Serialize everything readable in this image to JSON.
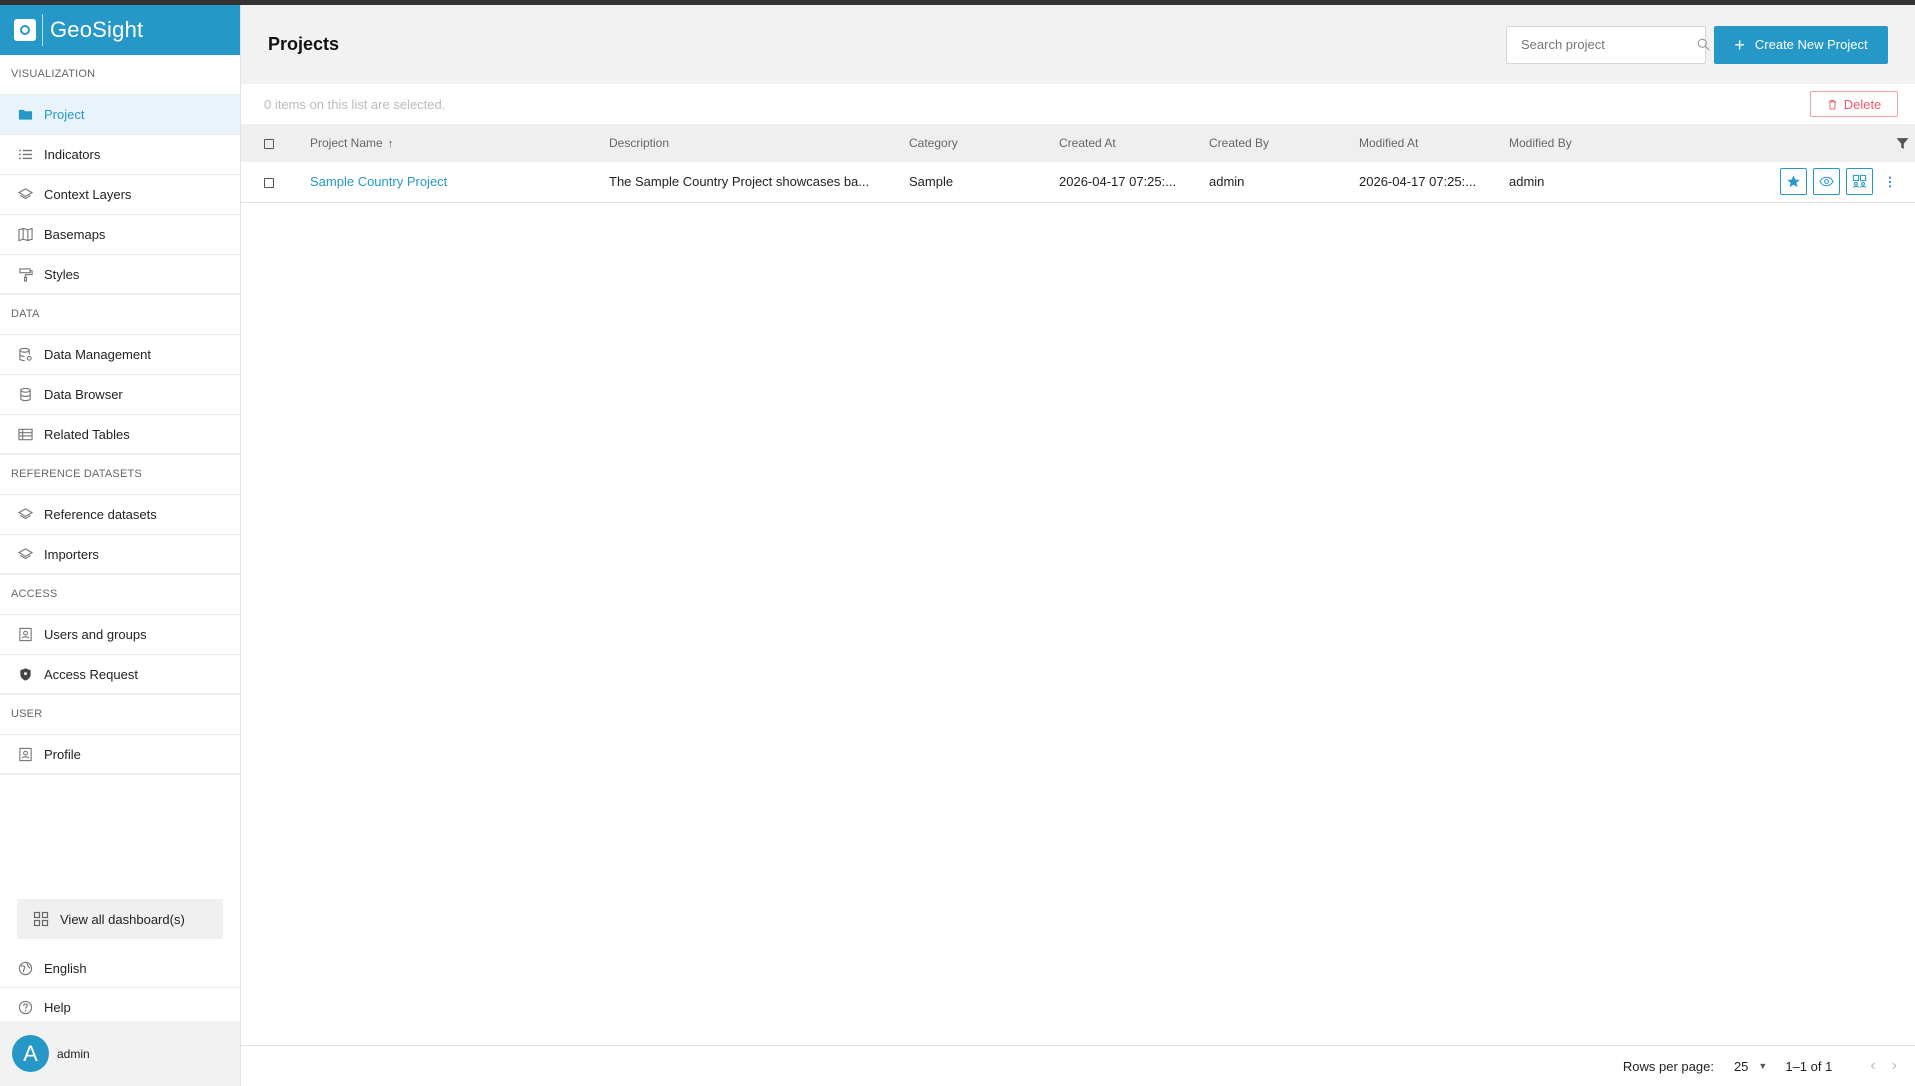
{
  "app": {
    "name": "GeoSight"
  },
  "sidebar": {
    "sections": [
      {
        "title": "VISUALIZATION",
        "items": [
          {
            "label": "Project",
            "icon": "folder-icon",
            "active": true
          },
          {
            "label": "Indicators",
            "icon": "list-icon"
          },
          {
            "label": "Context Layers",
            "icon": "layers-icon"
          },
          {
            "label": "Basemaps",
            "icon": "map-icon"
          },
          {
            "label": "Styles",
            "icon": "paint-roller-icon"
          }
        ]
      },
      {
        "title": "DATA",
        "items": [
          {
            "label": "Data Management",
            "icon": "database-gear-icon"
          },
          {
            "label": "Data Browser",
            "icon": "database-icon"
          },
          {
            "label": "Related Tables",
            "icon": "table-icon"
          }
        ]
      },
      {
        "title": "REFERENCE DATASETS",
        "items": [
          {
            "label": "Reference datasets",
            "icon": "layers-icon"
          },
          {
            "label": "Importers",
            "icon": "layers-icon"
          }
        ]
      },
      {
        "title": "ACCESS",
        "items": [
          {
            "label": "Users and groups",
            "icon": "user-card-icon"
          },
          {
            "label": "Access Request",
            "icon": "shield-icon"
          }
        ]
      },
      {
        "title": "USER",
        "items": [
          {
            "label": "Profile",
            "icon": "user-card-icon"
          }
        ]
      }
    ],
    "view_all_label": "View all dashboard(s)",
    "language_label": "English",
    "help_label": "Help",
    "user": {
      "initial": "A",
      "name": "admin"
    }
  },
  "header": {
    "title": "Projects",
    "search_placeholder": "Search project",
    "create_label": "Create New Project"
  },
  "selection": {
    "info": "0 items on this list are selected.",
    "delete_label": "Delete"
  },
  "table": {
    "columns": [
      "Project Name",
      "Description",
      "Category",
      "Created At",
      "Created By",
      "Modified At",
      "Modified By"
    ],
    "rows": [
      {
        "name": "Sample Country Project",
        "description": "The Sample Country Project showcases ba...",
        "category": "Sample",
        "created_at": "2026-04-17 07:25:...",
        "created_by": "admin",
        "modified_at": "2026-04-17 07:25:...",
        "modified_by": "admin"
      }
    ]
  },
  "footer": {
    "rows_per_page_label": "Rows per page:",
    "rows_per_page_value": "25",
    "range": "1–1 of 1"
  },
  "colors": {
    "accent": "#2698c8",
    "danger": "#e85a6a",
    "header_bg": "#f2f2f2"
  }
}
